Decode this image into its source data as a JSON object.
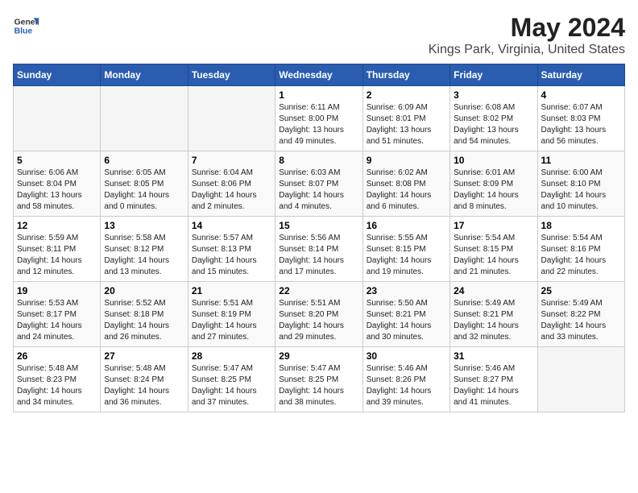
{
  "header": {
    "logo_general": "General",
    "logo_blue": "Blue",
    "title": "May 2024",
    "subtitle": "Kings Park, Virginia, United States"
  },
  "days_of_week": [
    "Sunday",
    "Monday",
    "Tuesday",
    "Wednesday",
    "Thursday",
    "Friday",
    "Saturday"
  ],
  "weeks": [
    [
      {
        "day": "",
        "sunrise": "",
        "sunset": "",
        "daylight": ""
      },
      {
        "day": "",
        "sunrise": "",
        "sunset": "",
        "daylight": ""
      },
      {
        "day": "",
        "sunrise": "",
        "sunset": "",
        "daylight": ""
      },
      {
        "day": "1",
        "sunrise": "Sunrise: 6:11 AM",
        "sunset": "Sunset: 8:00 PM",
        "daylight": "Daylight: 13 hours and 49 minutes."
      },
      {
        "day": "2",
        "sunrise": "Sunrise: 6:09 AM",
        "sunset": "Sunset: 8:01 PM",
        "daylight": "Daylight: 13 hours and 51 minutes."
      },
      {
        "day": "3",
        "sunrise": "Sunrise: 6:08 AM",
        "sunset": "Sunset: 8:02 PM",
        "daylight": "Daylight: 13 hours and 54 minutes."
      },
      {
        "day": "4",
        "sunrise": "Sunrise: 6:07 AM",
        "sunset": "Sunset: 8:03 PM",
        "daylight": "Daylight: 13 hours and 56 minutes."
      }
    ],
    [
      {
        "day": "5",
        "sunrise": "Sunrise: 6:06 AM",
        "sunset": "Sunset: 8:04 PM",
        "daylight": "Daylight: 13 hours and 58 minutes."
      },
      {
        "day": "6",
        "sunrise": "Sunrise: 6:05 AM",
        "sunset": "Sunset: 8:05 PM",
        "daylight": "Daylight: 14 hours and 0 minutes."
      },
      {
        "day": "7",
        "sunrise": "Sunrise: 6:04 AM",
        "sunset": "Sunset: 8:06 PM",
        "daylight": "Daylight: 14 hours and 2 minutes."
      },
      {
        "day": "8",
        "sunrise": "Sunrise: 6:03 AM",
        "sunset": "Sunset: 8:07 PM",
        "daylight": "Daylight: 14 hours and 4 minutes."
      },
      {
        "day": "9",
        "sunrise": "Sunrise: 6:02 AM",
        "sunset": "Sunset: 8:08 PM",
        "daylight": "Daylight: 14 hours and 6 minutes."
      },
      {
        "day": "10",
        "sunrise": "Sunrise: 6:01 AM",
        "sunset": "Sunset: 8:09 PM",
        "daylight": "Daylight: 14 hours and 8 minutes."
      },
      {
        "day": "11",
        "sunrise": "Sunrise: 6:00 AM",
        "sunset": "Sunset: 8:10 PM",
        "daylight": "Daylight: 14 hours and 10 minutes."
      }
    ],
    [
      {
        "day": "12",
        "sunrise": "Sunrise: 5:59 AM",
        "sunset": "Sunset: 8:11 PM",
        "daylight": "Daylight: 14 hours and 12 minutes."
      },
      {
        "day": "13",
        "sunrise": "Sunrise: 5:58 AM",
        "sunset": "Sunset: 8:12 PM",
        "daylight": "Daylight: 14 hours and 13 minutes."
      },
      {
        "day": "14",
        "sunrise": "Sunrise: 5:57 AM",
        "sunset": "Sunset: 8:13 PM",
        "daylight": "Daylight: 14 hours and 15 minutes."
      },
      {
        "day": "15",
        "sunrise": "Sunrise: 5:56 AM",
        "sunset": "Sunset: 8:14 PM",
        "daylight": "Daylight: 14 hours and 17 minutes."
      },
      {
        "day": "16",
        "sunrise": "Sunrise: 5:55 AM",
        "sunset": "Sunset: 8:15 PM",
        "daylight": "Daylight: 14 hours and 19 minutes."
      },
      {
        "day": "17",
        "sunrise": "Sunrise: 5:54 AM",
        "sunset": "Sunset: 8:15 PM",
        "daylight": "Daylight: 14 hours and 21 minutes."
      },
      {
        "day": "18",
        "sunrise": "Sunrise: 5:54 AM",
        "sunset": "Sunset: 8:16 PM",
        "daylight": "Daylight: 14 hours and 22 minutes."
      }
    ],
    [
      {
        "day": "19",
        "sunrise": "Sunrise: 5:53 AM",
        "sunset": "Sunset: 8:17 PM",
        "daylight": "Daylight: 14 hours and 24 minutes."
      },
      {
        "day": "20",
        "sunrise": "Sunrise: 5:52 AM",
        "sunset": "Sunset: 8:18 PM",
        "daylight": "Daylight: 14 hours and 26 minutes."
      },
      {
        "day": "21",
        "sunrise": "Sunrise: 5:51 AM",
        "sunset": "Sunset: 8:19 PM",
        "daylight": "Daylight: 14 hours and 27 minutes."
      },
      {
        "day": "22",
        "sunrise": "Sunrise: 5:51 AM",
        "sunset": "Sunset: 8:20 PM",
        "daylight": "Daylight: 14 hours and 29 minutes."
      },
      {
        "day": "23",
        "sunrise": "Sunrise: 5:50 AM",
        "sunset": "Sunset: 8:21 PM",
        "daylight": "Daylight: 14 hours and 30 minutes."
      },
      {
        "day": "24",
        "sunrise": "Sunrise: 5:49 AM",
        "sunset": "Sunset: 8:21 PM",
        "daylight": "Daylight: 14 hours and 32 minutes."
      },
      {
        "day": "25",
        "sunrise": "Sunrise: 5:49 AM",
        "sunset": "Sunset: 8:22 PM",
        "daylight": "Daylight: 14 hours and 33 minutes."
      }
    ],
    [
      {
        "day": "26",
        "sunrise": "Sunrise: 5:48 AM",
        "sunset": "Sunset: 8:23 PM",
        "daylight": "Daylight: 14 hours and 34 minutes."
      },
      {
        "day": "27",
        "sunrise": "Sunrise: 5:48 AM",
        "sunset": "Sunset: 8:24 PM",
        "daylight": "Daylight: 14 hours and 36 minutes."
      },
      {
        "day": "28",
        "sunrise": "Sunrise: 5:47 AM",
        "sunset": "Sunset: 8:25 PM",
        "daylight": "Daylight: 14 hours and 37 minutes."
      },
      {
        "day": "29",
        "sunrise": "Sunrise: 5:47 AM",
        "sunset": "Sunset: 8:25 PM",
        "daylight": "Daylight: 14 hours and 38 minutes."
      },
      {
        "day": "30",
        "sunrise": "Sunrise: 5:46 AM",
        "sunset": "Sunset: 8:26 PM",
        "daylight": "Daylight: 14 hours and 39 minutes."
      },
      {
        "day": "31",
        "sunrise": "Sunrise: 5:46 AM",
        "sunset": "Sunset: 8:27 PM",
        "daylight": "Daylight: 14 hours and 41 minutes."
      },
      {
        "day": "",
        "sunrise": "",
        "sunset": "",
        "daylight": ""
      }
    ]
  ]
}
